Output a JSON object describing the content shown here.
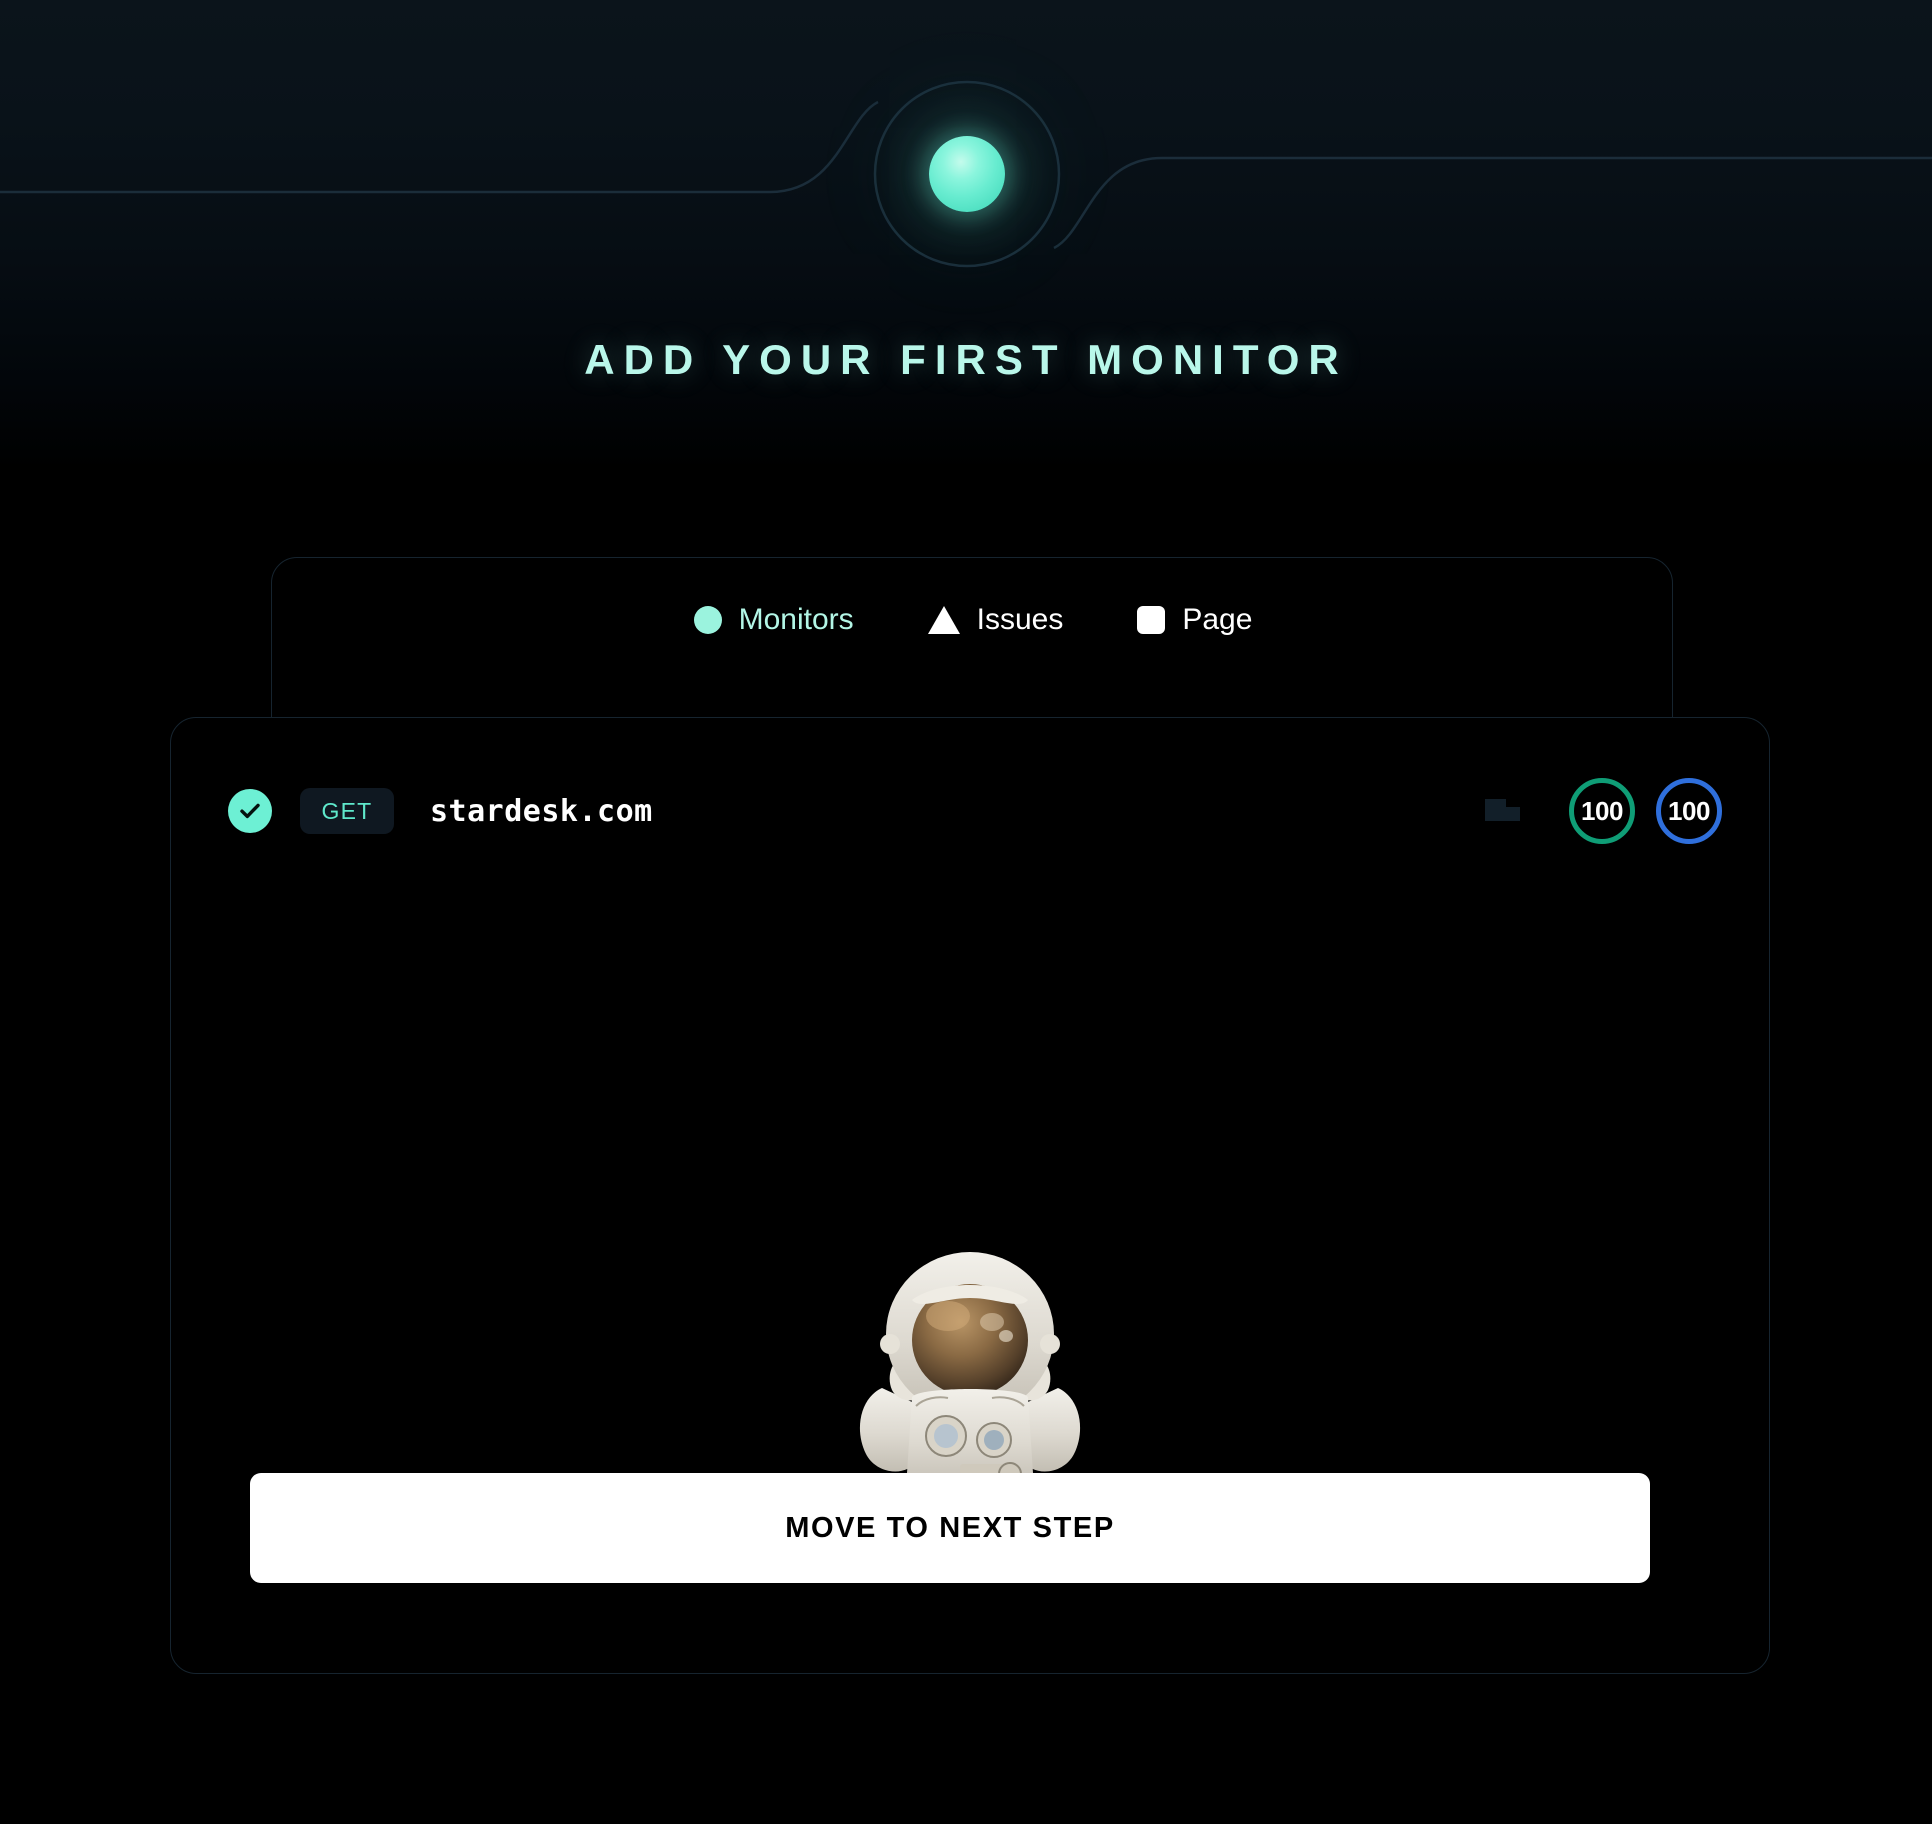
{
  "page": {
    "title": "ADD YOUR FIRST MONITOR",
    "background_color": "#000000",
    "accent_color": "#6df0d4"
  },
  "header": {
    "orb_icon": "glowing-orb",
    "orb_color": "#68ecd0",
    "line_color": "#16242f"
  },
  "tabs": [
    {
      "label": "Monitors",
      "icon": "circle-dot-icon",
      "active": true,
      "color": "#b3f6e6"
    },
    {
      "label": "Issues",
      "icon": "triangle-warning-icon",
      "active": false,
      "color": "#ffffff"
    },
    {
      "label": "Page",
      "icon": "square-page-icon",
      "active": false,
      "color": "#ffffff"
    }
  ],
  "monitor": {
    "status_icon": "check-circle-icon",
    "status_color": "#6df0d4",
    "method": "GET",
    "method_color": "#5fe8cb",
    "url": "stardesk.com",
    "chart_icon": "bar-chart-icon",
    "scores": [
      {
        "value": "100",
        "color": "#0f9d76",
        "name": "performance-score"
      },
      {
        "value": "100",
        "color": "#2f6fdc",
        "name": "accessibility-score"
      }
    ]
  },
  "illustration": {
    "name": "astronaut-thumbs-up",
    "alt": "Astronaut in white spacesuit with arms raised"
  },
  "cta": {
    "label": "MOVE TO NEXT STEP",
    "background": "#ffffff",
    "text_color": "#000000"
  }
}
